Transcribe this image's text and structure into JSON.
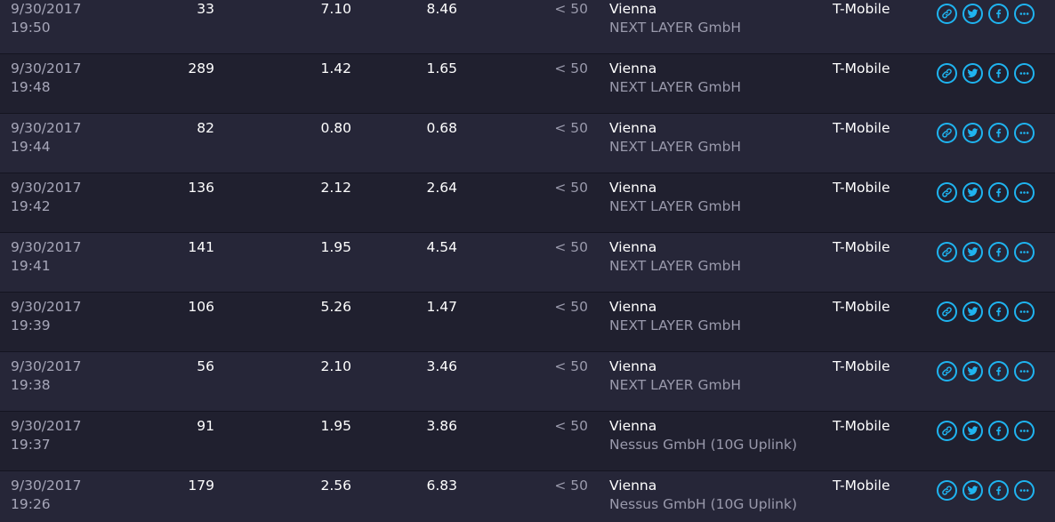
{
  "accent_color": "#1fb4f0",
  "share_icons": [
    "link-icon",
    "twitter-icon",
    "facebook-icon",
    "more-icon"
  ],
  "results": [
    {
      "date": "9/30/2017",
      "time": "19:50",
      "ping": "33",
      "download": "7.10",
      "upload": "8.46",
      "distance": "< 50",
      "city": "Vienna",
      "isp": "NEXT LAYER GmbH",
      "provider": "T-Mobile"
    },
    {
      "date": "9/30/2017",
      "time": "19:48",
      "ping": "289",
      "download": "1.42",
      "upload": "1.65",
      "distance": "< 50",
      "city": "Vienna",
      "isp": "NEXT LAYER GmbH",
      "provider": "T-Mobile"
    },
    {
      "date": "9/30/2017",
      "time": "19:44",
      "ping": "82",
      "download": "0.80",
      "upload": "0.68",
      "distance": "< 50",
      "city": "Vienna",
      "isp": "NEXT LAYER GmbH",
      "provider": "T-Mobile"
    },
    {
      "date": "9/30/2017",
      "time": "19:42",
      "ping": "136",
      "download": "2.12",
      "upload": "2.64",
      "distance": "< 50",
      "city": "Vienna",
      "isp": "NEXT LAYER GmbH",
      "provider": "T-Mobile"
    },
    {
      "date": "9/30/2017",
      "time": "19:41",
      "ping": "141",
      "download": "1.95",
      "upload": "4.54",
      "distance": "< 50",
      "city": "Vienna",
      "isp": "NEXT LAYER GmbH",
      "provider": "T-Mobile"
    },
    {
      "date": "9/30/2017",
      "time": "19:39",
      "ping": "106",
      "download": "5.26",
      "upload": "1.47",
      "distance": "< 50",
      "city": "Vienna",
      "isp": "NEXT LAYER GmbH",
      "provider": "T-Mobile"
    },
    {
      "date": "9/30/2017",
      "time": "19:38",
      "ping": "56",
      "download": "2.10",
      "upload": "3.46",
      "distance": "< 50",
      "city": "Vienna",
      "isp": "NEXT LAYER GmbH",
      "provider": "T-Mobile"
    },
    {
      "date": "9/30/2017",
      "time": "19:37",
      "ping": "91",
      "download": "1.95",
      "upload": "3.86",
      "distance": "< 50",
      "city": "Vienna",
      "isp": "Nessus GmbH (10G Uplink)",
      "provider": "T-Mobile"
    },
    {
      "date": "9/30/2017",
      "time": "19:26",
      "ping": "179",
      "download": "2.56",
      "upload": "6.83",
      "distance": "< 50",
      "city": "Vienna",
      "isp": "Nessus GmbH (10G Uplink)",
      "provider": "T-Mobile"
    }
  ]
}
